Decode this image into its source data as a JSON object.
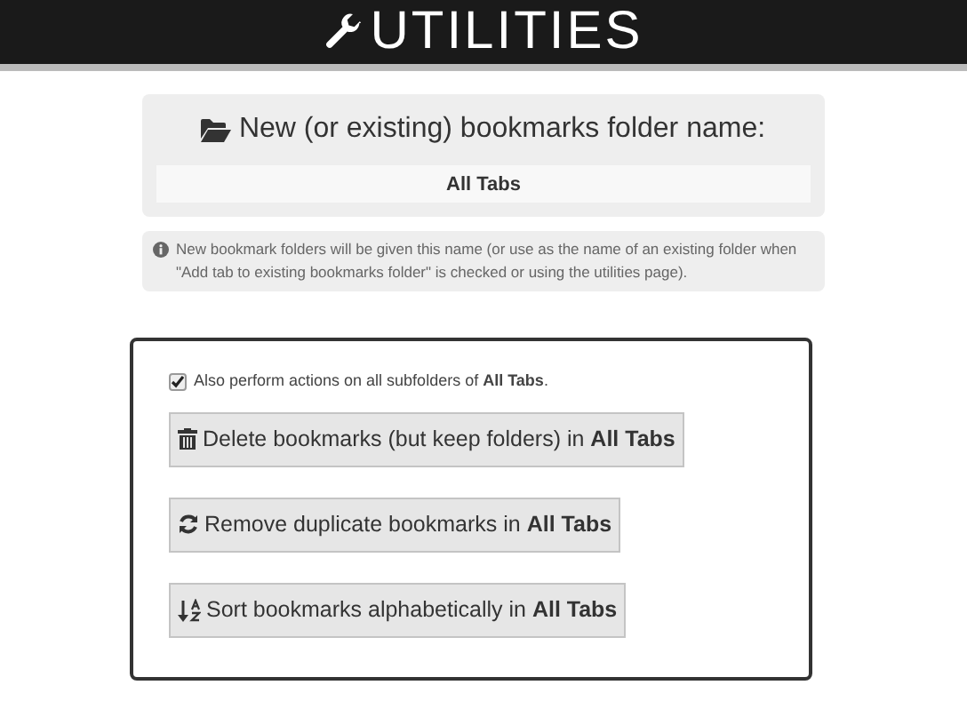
{
  "header": {
    "title": "UTILITIES"
  },
  "folder": {
    "label": "New (or existing) bookmarks folder name:",
    "value": "All Tabs"
  },
  "note": "New bookmark folders will be given this name (or use as the name of an existing folder when \"Add tab to existing bookmarks folder\" is checked or using the utilities page).",
  "subfolders": {
    "label": "Also perform actions on all subfolders of **All Tabs**.",
    "checked": true
  },
  "actions": [
    {
      "kind": "delete",
      "label": "Delete bookmarks (but keep folders) in **All Tabs**"
    },
    {
      "kind": "dedupe",
      "label": "Remove duplicate bookmarks in **All Tabs**"
    },
    {
      "kind": "sort",
      "label": "Sort bookmarks alphabetically in **All Tabs**"
    }
  ]
}
